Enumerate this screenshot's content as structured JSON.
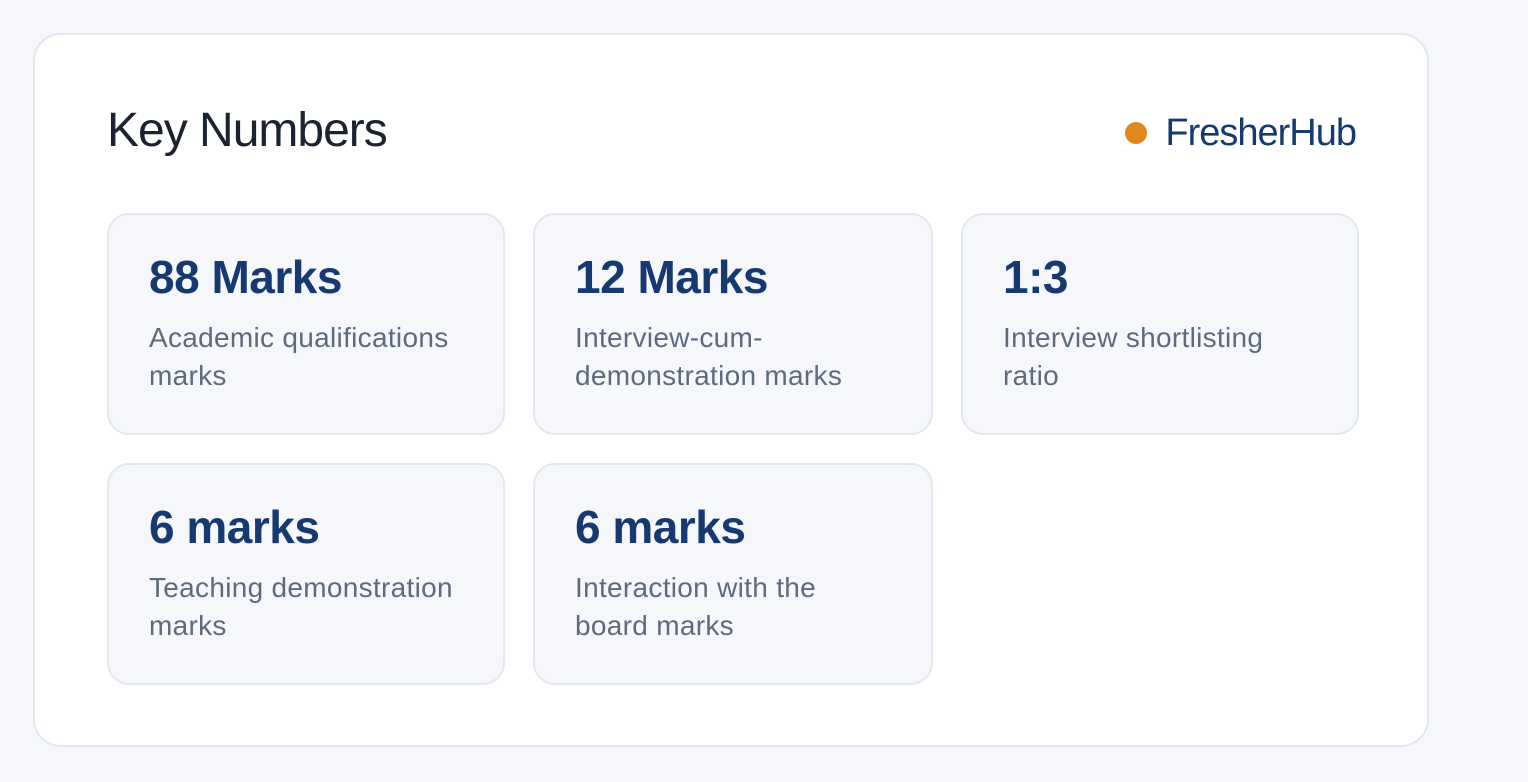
{
  "header": {
    "title": "Key Numbers",
    "brand": "FresherHub"
  },
  "colors": {
    "brand_dot": "#e3861c",
    "value_text": "#163a70",
    "label_text": "#5e6a7e"
  },
  "stats": [
    {
      "value": "88 Marks",
      "label": "Academic qualifications marks"
    },
    {
      "value": "12 Marks",
      "label": "Interview-cum-demonstration marks"
    },
    {
      "value": "1:3",
      "label": "Interview shortlisting ratio"
    },
    {
      "value": "6 marks",
      "label": "Teaching demonstration marks"
    },
    {
      "value": "6 marks",
      "label": "Interaction with the board marks"
    }
  ]
}
